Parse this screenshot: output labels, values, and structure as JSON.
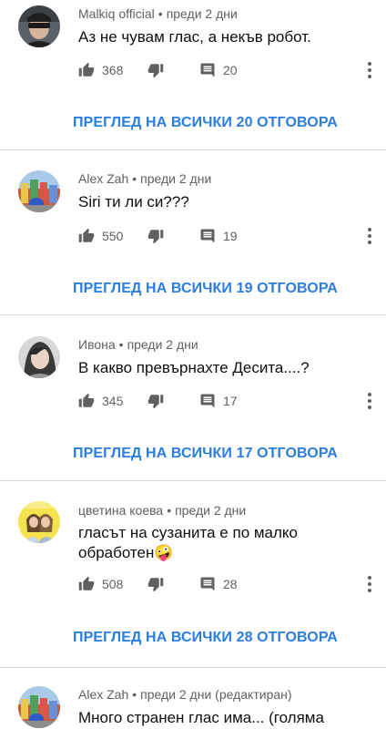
{
  "comments": [
    {
      "author": "Malkiq official",
      "time": "преди 2 дни",
      "edited": "",
      "text": "Аз не чувам глас, а некъв робот.",
      "likes": "368",
      "replies_count": "20",
      "view_replies": "ПРЕГЛЕД НА ВСИЧКИ 20 ОТГОВОРА"
    },
    {
      "author": "Alex Zah",
      "time": "преди 2 дни",
      "edited": "",
      "text": "Siri ти ли си???",
      "likes": "550",
      "replies_count": "19",
      "view_replies": "ПРЕГЛЕД НА ВСИЧКИ 19 ОТГОВОРА"
    },
    {
      "author": "Ивона",
      "time": "преди 2 дни",
      "edited": "",
      "text": "В какво превърнахте Десита....?",
      "likes": "345",
      "replies_count": "17",
      "view_replies": "ПРЕГЛЕД НА ВСИЧКИ 17 ОТГОВОРА"
    },
    {
      "author": "цветина коева",
      "time": "преди 2 дни",
      "edited": "",
      "text": "гласът на сузанита е по малко обработен🤪",
      "likes": "508",
      "replies_count": "28",
      "view_replies": "ПРЕГЛЕД НА ВСИЧКИ 28 ОТГОВОРА"
    },
    {
      "author": "Alex Zah",
      "time": "преди 2 дни",
      "edited": "(редактиран)",
      "text": "Много странен глас има... (голяма",
      "likes": "",
      "replies_count": "",
      "view_replies": ""
    }
  ],
  "icons": {
    "like": "thumb-up-icon",
    "dislike": "thumb-down-icon",
    "reply": "comment-icon",
    "more": "more-vert-icon"
  },
  "colors": {
    "link": "#2b7de0",
    "secondary_text": "#606060",
    "icon": "#606060",
    "divider": "#d9d9d9"
  }
}
